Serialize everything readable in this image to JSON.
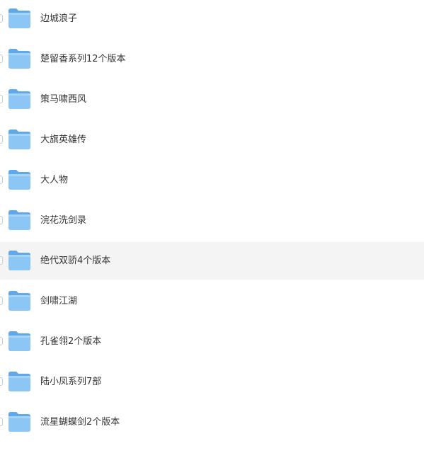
{
  "colors": {
    "folder_back": "#5fa8ea",
    "folder_front": "#8cc6f5",
    "folder_highlight": "#b7dcfa",
    "text": "#333333",
    "hover_bg": "#f4f4f5"
  },
  "folders": [
    {
      "name": "边城浪子",
      "icon": "folder-icon"
    },
    {
      "name": "楚留香系列12个版本",
      "icon": "folder-icon"
    },
    {
      "name": "策马啸西风",
      "icon": "folder-icon"
    },
    {
      "name": "大旗英雄传",
      "icon": "folder-icon"
    },
    {
      "name": "大人物",
      "icon": "folder-icon"
    },
    {
      "name": "浣花洗剑录",
      "icon": "folder-icon"
    },
    {
      "name": "绝代双骄4个版本",
      "icon": "folder-icon",
      "hovered": true
    },
    {
      "name": "剑啸江湖",
      "icon": "folder-icon"
    },
    {
      "name": "孔雀翎2个版本",
      "icon": "folder-icon"
    },
    {
      "name": "陆小凤系列7部",
      "icon": "folder-icon"
    },
    {
      "name": "流星蝴蝶剑2个版本",
      "icon": "folder-icon"
    }
  ]
}
